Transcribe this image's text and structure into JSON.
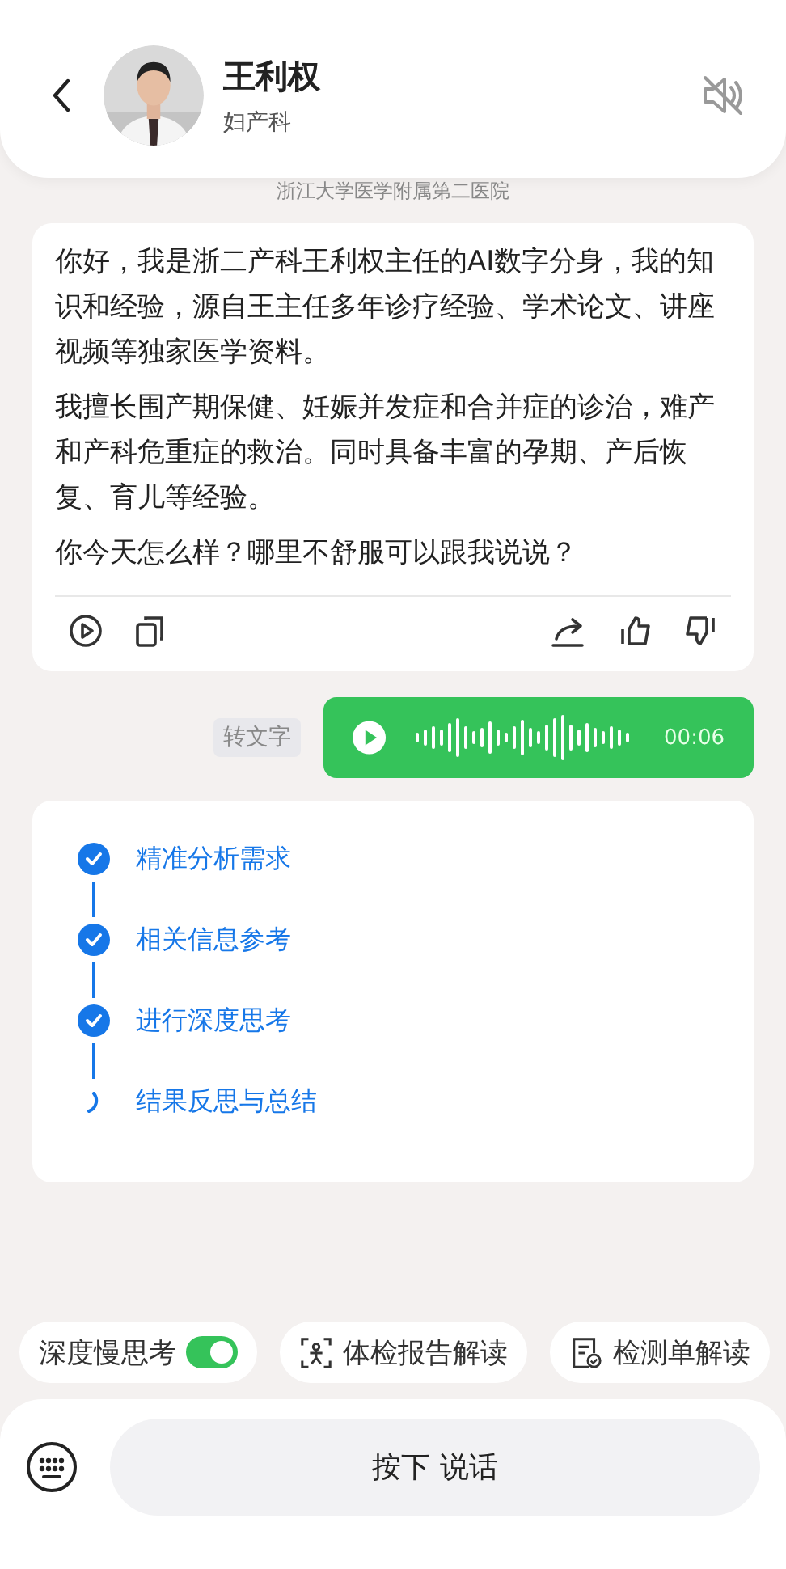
{
  "header": {
    "name": "王利权",
    "department": "妇产科",
    "muted": true
  },
  "hospital": "浙江大学医学附属第二医院",
  "message": {
    "paragraphs": [
      "你好，我是浙二产科王利权主任的AI数字分身，我的知识和经验，源自王主任多年诊疗经验、学术论文、讲座视频等独家医学资料。",
      "我擅长围产期保健、妊娠并发症和合并症的诊治，难产和产科危重症的救治。同时具备丰富的孕期、产后恢复、育儿等经验。",
      "你今天怎么样？哪里不舒服可以跟我说说？"
    ]
  },
  "voice": {
    "transcribe": "转文字",
    "duration": "00:06"
  },
  "steps": [
    {
      "label": "精准分析需求",
      "done": true
    },
    {
      "label": "相关信息参考",
      "done": true
    },
    {
      "label": "进行深度思考",
      "done": true
    },
    {
      "label": "结果反思与总结",
      "done": false
    }
  ],
  "chips": [
    {
      "kind": "toggle",
      "label": "深度慢思考",
      "on": true
    },
    {
      "kind": "scan",
      "label": "体检报告解读"
    },
    {
      "kind": "doc",
      "label": "检测单解读"
    }
  ],
  "input": {
    "label": "按下 说话"
  }
}
